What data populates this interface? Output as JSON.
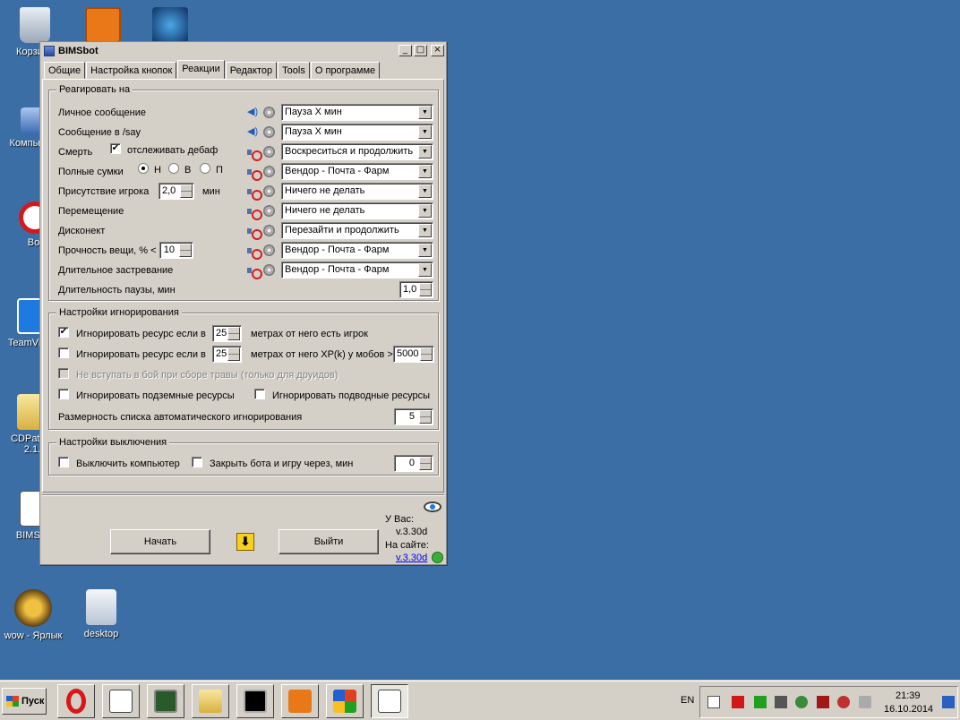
{
  "desktop": {
    "icons": [
      {
        "label": "Корзина"
      },
      {
        "label": ""
      },
      {
        "label": ""
      },
      {
        "label": "Компьютер"
      },
      {
        "label": "Bot"
      },
      {
        "label": "TeamViewer"
      },
      {
        "label": "CDPatcher 2.1.1"
      },
      {
        "label": "BIMSbot"
      },
      {
        "label": "wow - Ярлык"
      },
      {
        "label": "desktop"
      }
    ]
  },
  "window": {
    "title": "BIMSbot",
    "tabs": [
      "Общие",
      "Настройка кнопок",
      "Реакции",
      "Редактор",
      "Tools",
      "О программе"
    ],
    "active_tab": "Реакции"
  },
  "react": {
    "legend": "Реагировать на",
    "rows": [
      {
        "label": "Личное сообщение",
        "action": "Пауза X мин",
        "sound": "speaker-icon"
      },
      {
        "label": "Сообщение в /say",
        "action": "Пауза X мин",
        "sound": "speaker-icon"
      },
      {
        "label": "Смерть",
        "action": "Воскреситься и продолжить",
        "sound": "mute-icon"
      },
      {
        "label": "Полные сумки",
        "action": "Вендор - Почта - Фарм",
        "sound": "mute-icon"
      },
      {
        "label": "Присутствие игрока",
        "action": "Ничего не делать",
        "sound": "mute-icon"
      },
      {
        "label": "Перемещение",
        "action": "Ничего не делать",
        "sound": "mute-icon"
      },
      {
        "label": "Дисконект",
        "action": "Перезайти и продолжить",
        "sound": "mute-icon"
      },
      {
        "label": "Прочность вещи, % <",
        "action": "Вендор - Почта - Фарм",
        "sound": "mute-icon"
      },
      {
        "label": "Длительное застревание",
        "action": "Вендор - Почта - Фарм",
        "sound": "mute-icon"
      }
    ],
    "debuff_label": "отслеживать дебаф",
    "debuff_checked": true,
    "bags_options": [
      "Н",
      "В",
      "П"
    ],
    "bags_selected": "Н",
    "player_value": "2,0",
    "player_unit": "мин",
    "durability_value": "10",
    "pause_label": "Длительность паузы, мин",
    "pause_value": "1,0"
  },
  "ignore": {
    "legend": "Настройки игнорирования",
    "row1_label": "Игнорировать ресурс если в",
    "row1_value": "25",
    "row1_suffix": "метрах от него есть игрок",
    "row1_checked": true,
    "row2_label": "Игнорировать ресурс если в",
    "row2_value": "25",
    "row2_suffix": "метрах от него XP(k) у мобов >",
    "row2_xp": "5000",
    "row2_checked": false,
    "druid_label": "Не вступать в бой при сборе травы (только для друидов)",
    "underground_label": "Игнорировать подземные ресурсы",
    "underwater_label": "Игнорировать подводные ресурсы",
    "list_size_label": "Размерность списка автоматического игнорирования",
    "list_size_value": "5"
  },
  "shutdown": {
    "legend": "Настройки выключения",
    "pc_label": "Выключить компьютер",
    "close_label": "Закрыть бота и игру через, мин",
    "close_value": "0"
  },
  "footer": {
    "start_label": "Начать",
    "exit_label": "Выйти",
    "you_have_label": "У Вас:",
    "local_version": "v.3.30d",
    "site_label": "На сайте:",
    "site_version": "v.3.30d"
  },
  "taskbar": {
    "start_label": "Пуск",
    "lang": "EN",
    "time": "21:39",
    "date": "16.10.2014"
  }
}
